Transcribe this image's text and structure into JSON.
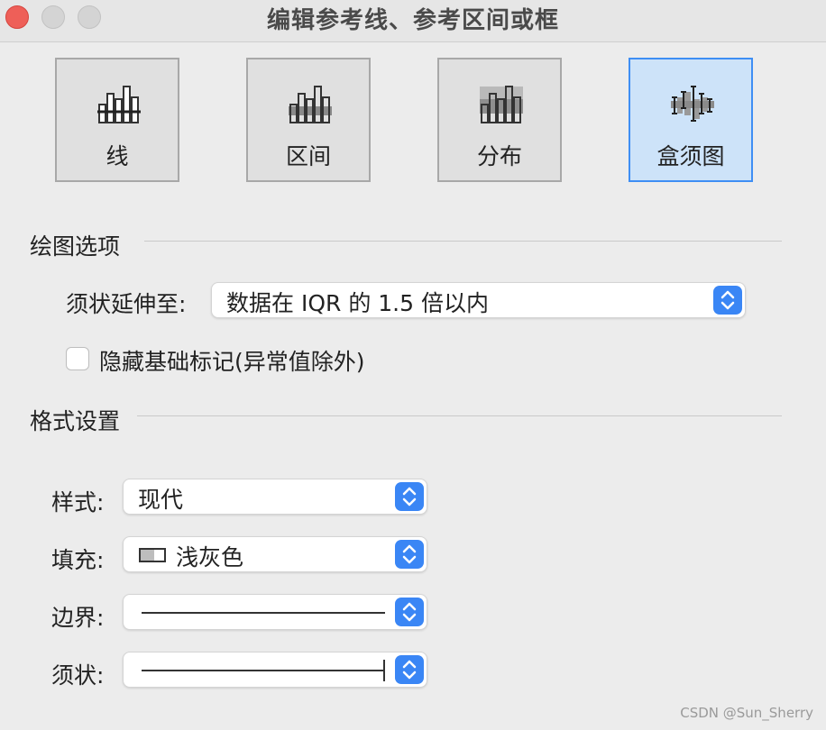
{
  "window": {
    "title": "编辑参考线、参考区间或框"
  },
  "type_buttons": [
    {
      "label": "线",
      "icon": "line-reference-icon",
      "selected": false
    },
    {
      "label": "区间",
      "icon": "band-reference-icon",
      "selected": false
    },
    {
      "label": "分布",
      "icon": "distribution-reference-icon",
      "selected": false
    },
    {
      "label": "盒须图",
      "icon": "box-plot-icon",
      "selected": true
    }
  ],
  "plot_options": {
    "section_title": "绘图选项",
    "whisker_label": "须状延伸至:",
    "whisker_value": "数据在 IQR 的 1.5 倍以内",
    "hide_marks_label": "隐藏基础标记(异常值除外)",
    "hide_marks_checked": false
  },
  "format": {
    "section_title": "格式设置",
    "style_label": "样式:",
    "style_value": "现代",
    "fill_label": "填充:",
    "fill_value": "浅灰色",
    "border_label": "边界:",
    "whisker_label": "须状:"
  },
  "watermark": "CSDN @Sun_Sherry",
  "colors": {
    "accent": "#3a86f5",
    "selected_bg": "#cde3f9",
    "close_button": "#ee5f58"
  }
}
